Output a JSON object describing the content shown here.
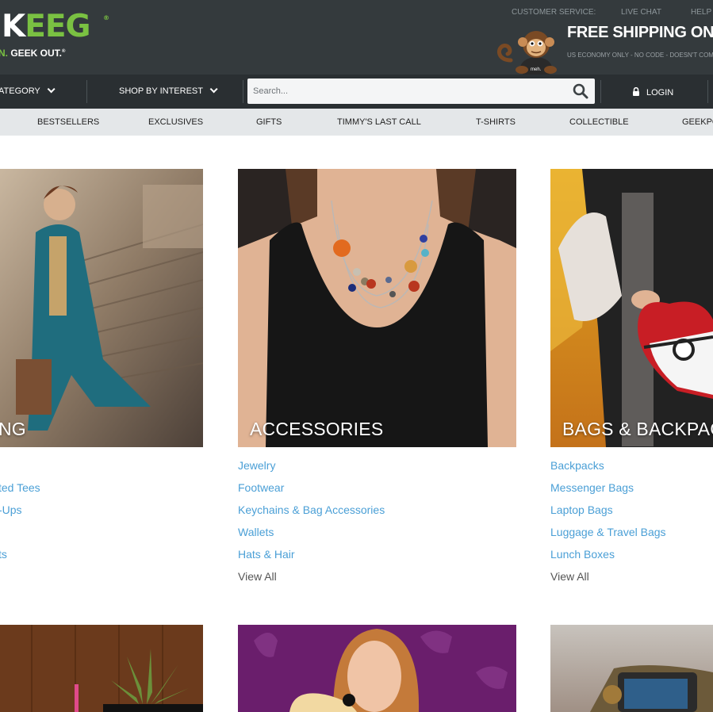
{
  "header": {
    "logo_text_white": "K",
    "logo_text_green": "EEG",
    "logo_tm": "®",
    "tagline_green": "N.",
    "tagline_white": "GEEK OUT.",
    "tagline_mark": "®",
    "customer_service": "CUSTOMER SERVICE:",
    "live_chat": "LIVE CHAT",
    "help": "HELP",
    "mascot_shirt": "meh.",
    "shipping_headline": "FREE SHIPPING ON C",
    "shipping_sub": "US ECONOMY ONLY - NO CODE - DOESN'T COMB"
  },
  "nav": {
    "category": "ATEGORY",
    "shop_by_interest": "SHOP BY INTEREST",
    "search_placeholder": "Search...",
    "login": "LOGIN"
  },
  "subnav": [
    "BESTSELLERS",
    "EXCLUSIVES",
    "GIFTS",
    "TIMMY'S LAST CALL",
    "T-SHIRTS",
    "COLLECTIBLE",
    "GEEKPO"
  ],
  "categories": [
    {
      "caption": "NG",
      "links": [
        "",
        "ted Tees",
        "-Ups",
        "",
        "ts",
        ""
      ]
    },
    {
      "caption": "ACCESSORIES",
      "links": [
        "Jewelry",
        "Footwear",
        "Keychains & Bag Accessories",
        "Wallets",
        "Hats & Hair",
        "View All"
      ]
    },
    {
      "caption": "BAGS & BACKPACH",
      "links": [
        "Backpacks",
        "Messenger Bags",
        "Laptop Bags",
        "Luggage & Travel Bags",
        "Lunch Boxes",
        "View All"
      ]
    }
  ],
  "colors": {
    "header_bg": "#343a3d",
    "nav_bg": "#2a2f32",
    "subnav_bg": "#e4e7e9",
    "brand_green": "#7ac142",
    "link_blue": "#4a9fd6"
  },
  "icons": {
    "search": "magnifier-icon",
    "login": "lock-icon",
    "dropdown": "chevron-down-icon"
  }
}
